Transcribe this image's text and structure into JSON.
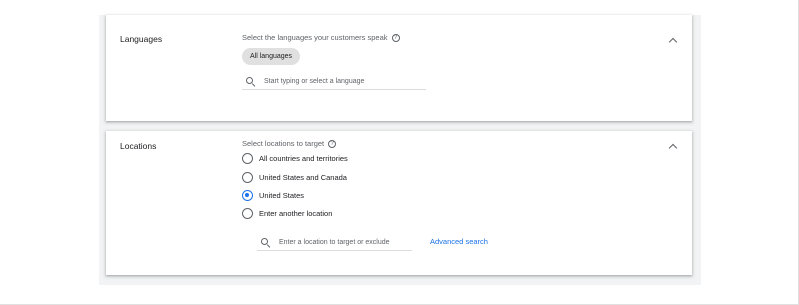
{
  "languages": {
    "title": "Languages",
    "prompt": "Select the languages your customers speak",
    "help_icon": "?",
    "chip": "All languages",
    "search_placeholder": "Start typing or select a language"
  },
  "locations": {
    "title": "Locations",
    "prompt": "Select locations to target",
    "help_icon": "?",
    "options": [
      {
        "label": "All countries and territories",
        "selected": false
      },
      {
        "label": "United States and Canada",
        "selected": false
      },
      {
        "label": "United States",
        "selected": true
      },
      {
        "label": "Enter another location",
        "selected": false
      }
    ],
    "search_placeholder": "Enter a location to target or exclude",
    "advanced_search": "Advanced search"
  },
  "colors": {
    "accent": "#1a73e8",
    "text": "#202124",
    "muted": "#5f6368",
    "chip_bg": "#e0e0e0",
    "panel_bg": "#f1f3f4"
  }
}
